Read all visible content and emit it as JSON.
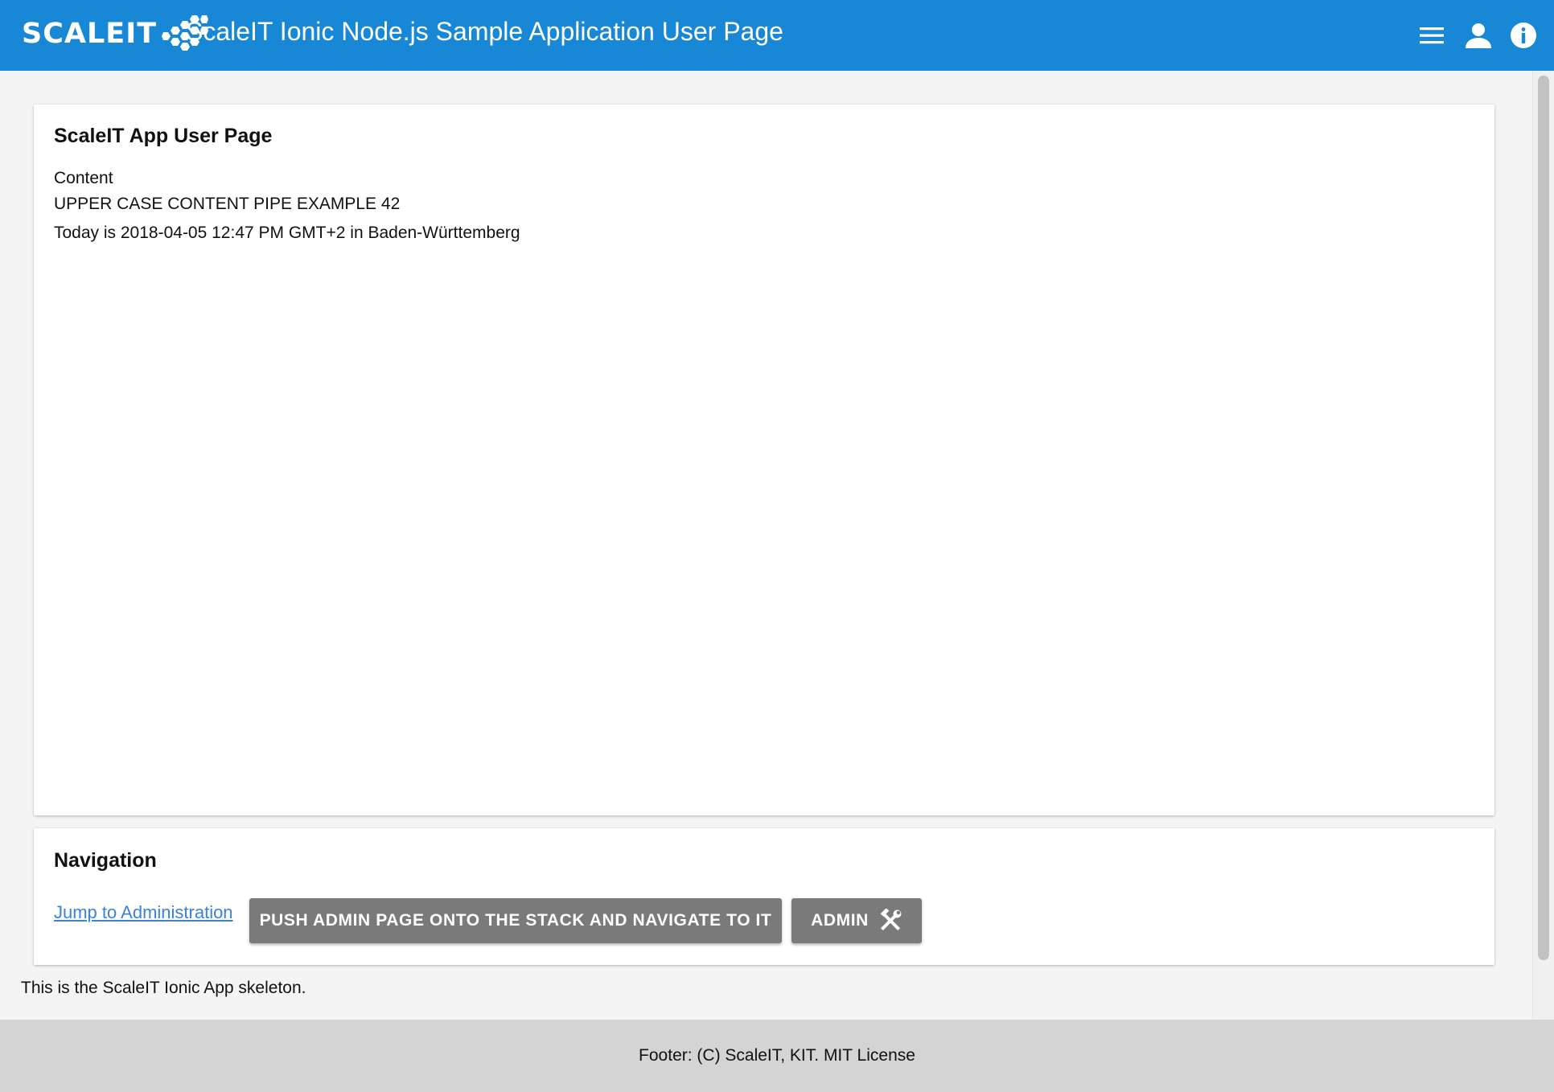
{
  "header": {
    "logo_text": "SCALEIT",
    "title": "ScaleIT Ionic Node.js Sample Application User Page",
    "icons": [
      "menu-icon",
      "person-icon",
      "info-icon"
    ]
  },
  "user_card": {
    "title": "ScaleIT App User Page",
    "lines": [
      "Content",
      "UPPER CASE CONTENT PIPE EXAMPLE 42",
      "Today is 2018-04-05 12:47 PM GMT+2 in Baden-Württemberg"
    ]
  },
  "nav_card": {
    "title": "Navigation",
    "link_label": "Jump to Administration",
    "push_button_label": "PUSH ADMIN PAGE ONTO THE STACK AND NAVIGATE TO IT",
    "admin_button_label": "ADMIN"
  },
  "skeleton_text": "This is the ScaleIT Ionic App skeleton.",
  "footer": {
    "text": "Footer: (C) ScaleIT, KIT. MIT License"
  },
  "colors": {
    "header": "#1888d6",
    "button": "#7a7a7a",
    "link": "#3b83d8",
    "footer": "#d4d4d4",
    "background": "#f4f4f4"
  }
}
